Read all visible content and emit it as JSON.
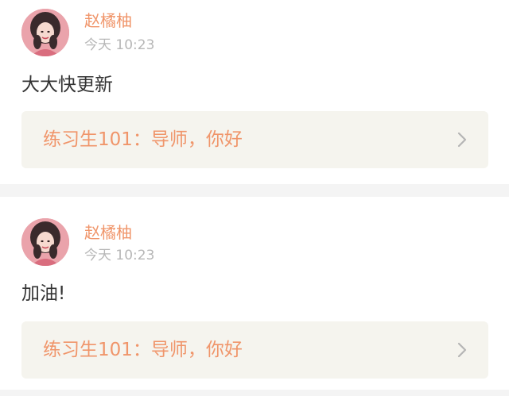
{
  "posts": [
    {
      "username": "赵橘柚",
      "timestamp": "今天 10:23",
      "content": "大大快更新",
      "link": {
        "title": "练习生101：导师，你好",
        "icon": "chevron-right-icon"
      }
    },
    {
      "username": "赵橘柚",
      "timestamp": "今天 10:23",
      "content": "加油!",
      "link": {
        "title": "练习生101：导师，你好",
        "icon": "chevron-right-icon"
      }
    }
  ],
  "colors": {
    "accent": "#f0956a",
    "timestamp": "#b7b7b7",
    "content": "#333333",
    "link_bg": "#f5f4ee",
    "page_bg": "#f4f4f4"
  }
}
